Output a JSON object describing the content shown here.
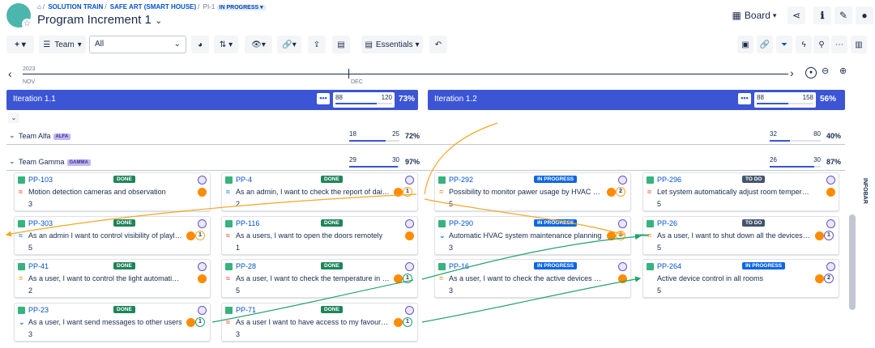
{
  "breadcrumb": {
    "items": [
      "SOLUTION TRAIN",
      "SAFE ART (SMART HOUSE)",
      "PI-1"
    ],
    "status": "IN PROGRESS"
  },
  "page_title": "Program Increment 1",
  "view": {
    "label": "Board"
  },
  "toolbar": {
    "team_label": "Team",
    "team_select": "All",
    "essentials_label": "Essentials"
  },
  "timeline": {
    "year": "2023",
    "months": [
      "NOV",
      "DEC"
    ]
  },
  "iterations": [
    {
      "name": "Iteration 1.1",
      "done": "88",
      "total": "120",
      "pct": "73%",
      "fill": 0.73
    },
    {
      "name": "Iteration 1.2",
      "done": "88",
      "total": "158",
      "pct": "56%",
      "fill": 0.56
    }
  ],
  "teams": [
    {
      "name": "Team Alfa",
      "tag": "ALFA",
      "i1": {
        "done": "18",
        "total": "25",
        "pct": "72%",
        "fill": 0.72
      },
      "i2": {
        "done": "32",
        "total": "80",
        "pct": "40%",
        "fill": 0.4
      }
    },
    {
      "name": "Team Gamma",
      "tag": "GAMMA",
      "i1": {
        "done": "29",
        "total": "30",
        "pct": "97%",
        "fill": 0.97
      },
      "i2": {
        "done": "26",
        "total": "30",
        "pct": "87%",
        "fill": 0.87
      }
    }
  ],
  "cards": [
    {
      "key": "PP-103",
      "status": "DONE",
      "summary": "Motion detection cameras and observation",
      "points": "3",
      "priority": "high",
      "count": ""
    },
    {
      "key": "PP-4",
      "status": "DONE",
      "summary": "As an admin, I want to check the report of daily usage",
      "points": "2",
      "priority": "low",
      "count": "1"
    },
    {
      "key": "PP-292",
      "status": "IN PROGRESS",
      "summary": "Possibility to monitor pawer usage by HVAC system",
      "points": "5",
      "priority": "medium",
      "count": "2"
    },
    {
      "key": "PP-296",
      "status": "TO DO",
      "summary": "Let system automatically adjust room temperature based on presence",
      "points": "5",
      "priority": "high",
      "count": ""
    },
    {
      "key": "PP-303",
      "status": "DONE",
      "summary": "As an admin I want to control visibility of playlists and content",
      "points": "5",
      "priority": "low",
      "count": "1"
    },
    {
      "key": "PP-116",
      "status": "DONE",
      "summary": "As a users, I want to open the doors remotely",
      "points": "1",
      "priority": "high",
      "count": ""
    },
    {
      "key": "PP-290",
      "status": "IN PROGRESS",
      "summary": "Automatic HVAC system maintenance planning",
      "points": "3",
      "priority": "minor",
      "count": "1"
    },
    {
      "key": "PP-26",
      "status": "TO DO",
      "summary": "As a user, I want to shut down all the devices remotely",
      "points": "5",
      "priority": "medium",
      "count": "1"
    },
    {
      "key": "PP-41",
      "status": "DONE",
      "summary": "As a user, I want to control the light automatically",
      "points": "2",
      "priority": "medium",
      "count": ""
    },
    {
      "key": "PP-28",
      "status": "DONE",
      "summary": "As a user, I want to check the temperature in all rooms",
      "points": "5",
      "priority": "high",
      "count": "1"
    },
    {
      "key": "PP-16",
      "status": "IN PROGRESS",
      "summary": "As a user, I want to check the active devices in all rooms",
      "points": "3",
      "priority": "medium",
      "count": ""
    },
    {
      "key": "PP-264",
      "status": "IN PROGRESS",
      "summary": "Active device control in all rooms",
      "points": "5",
      "priority": "none",
      "count": "2"
    },
    {
      "key": "PP-23",
      "status": "DONE",
      "summary": "As a user, I want send messages to other users",
      "points": "3",
      "priority": "minor",
      "count": "1"
    },
    {
      "key": "PP-71",
      "status": "DONE",
      "summary": "As a user I want to have access to my favourite playlists",
      "points": "3",
      "priority": "high",
      "count": "1"
    }
  ],
  "infobar": "INFOBAR",
  "colors": {
    "accent": "#3b55d4",
    "done": "#1f845a",
    "in_progress": "#0c66e4",
    "todo": "#44546f",
    "link_orange": "#f5a623",
    "link_green": "#22a06b"
  }
}
